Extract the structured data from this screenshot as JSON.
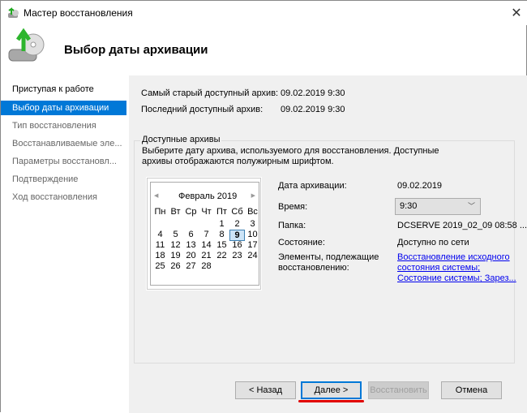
{
  "window": {
    "title": "Мастер восстановления",
    "close": "✕"
  },
  "header": {
    "title": "Выбор даты архивации"
  },
  "sidebar": {
    "items": [
      {
        "label": "Приступая к работе"
      },
      {
        "label": "Выбор даты архивации"
      },
      {
        "label": "Тип восстановления"
      },
      {
        "label": "Восстанавливаемые эле..."
      },
      {
        "label": "Параметры восстановл..."
      },
      {
        "label": "Подтверждение"
      },
      {
        "label": "Ход восстановления"
      }
    ]
  },
  "info": {
    "oldest_label": "Самый старый доступный архив:",
    "oldest_value": "09.02.2019 9:30",
    "latest_label": "Последний доступный архив:",
    "latest_value": "09.02.2019 9:30"
  },
  "group": {
    "title": "Доступные архивы",
    "description": "Выберите дату архива, используемого для восстановления. Доступные архивы отображаются полужирным шрифтом."
  },
  "calendar": {
    "month": "Февраль 2019",
    "prev": "◀",
    "next": "▶",
    "weekdays": [
      "Пн",
      "Вт",
      "Ср",
      "Чт",
      "Пт",
      "Сб",
      "Вс"
    ],
    "first_weekday_index": 4,
    "days_in_month": 28,
    "selected_day": 9,
    "bold_days": [
      9
    ]
  },
  "details": {
    "date_label": "Дата архивации:",
    "date_value": "09.02.2019",
    "time_label": "Время:",
    "time_value": "9:30",
    "folder_label": "Папка:",
    "folder_value": "DCSERVE 2019_02_09 08:58 ...",
    "state_label": "Состояние:",
    "state_value": "Доступно по сети",
    "items_label_1": "Элементы, подлежащие",
    "items_label_2": "восстановлению:",
    "items_link_1": "Восстановление исходного",
    "items_link_2": "состояния системы;",
    "items_link_3": "Состояние системы; Зарез..."
  },
  "buttons": {
    "back": "< Назад",
    "next": "Далее >",
    "restore": "Восстановить",
    "cancel": "Отмена"
  },
  "colors": {
    "accent": "#0078d7",
    "highlight": "#e00000"
  }
}
